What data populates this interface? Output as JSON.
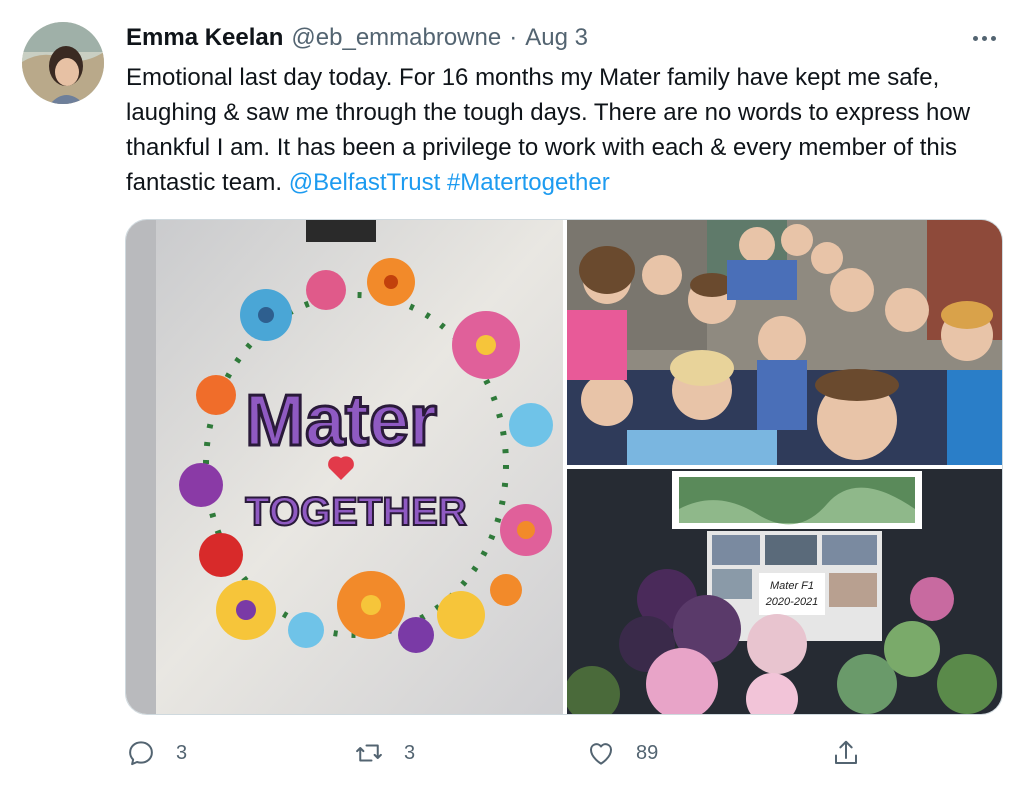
{
  "tweet": {
    "author": {
      "name": "Emma Keelan",
      "handle": "@eb_emmabrowne",
      "separator": "·",
      "date": "Aug 3"
    },
    "text_main": "Emotional last day today. For 16 months my Mater family have kept me safe, laughing & saw me through the tough days. There are no words to express how thankful I am. It has been a privilege to work with each & every member of this fantastic team.",
    "mention": "@BelfastTrust",
    "hashtag": "#Matertogether",
    "media": {
      "photo_left": {
        "words": [
          "Mater",
          "TOGETHER"
        ]
      },
      "photo_bottom_right": {
        "card_line1": "Mater F1",
        "card_line2": "2020-2021"
      }
    },
    "actions": {
      "reply_count": "3",
      "retweet_count": "3",
      "like_count": "89"
    },
    "icons": {
      "more": "more-horizontal-icon",
      "reply": "reply-icon",
      "retweet": "retweet-icon",
      "like": "heart-icon",
      "share": "share-icon"
    },
    "colors": {
      "text": "#0f1419",
      "secondary": "#536471",
      "link": "#1d9bf0"
    }
  }
}
